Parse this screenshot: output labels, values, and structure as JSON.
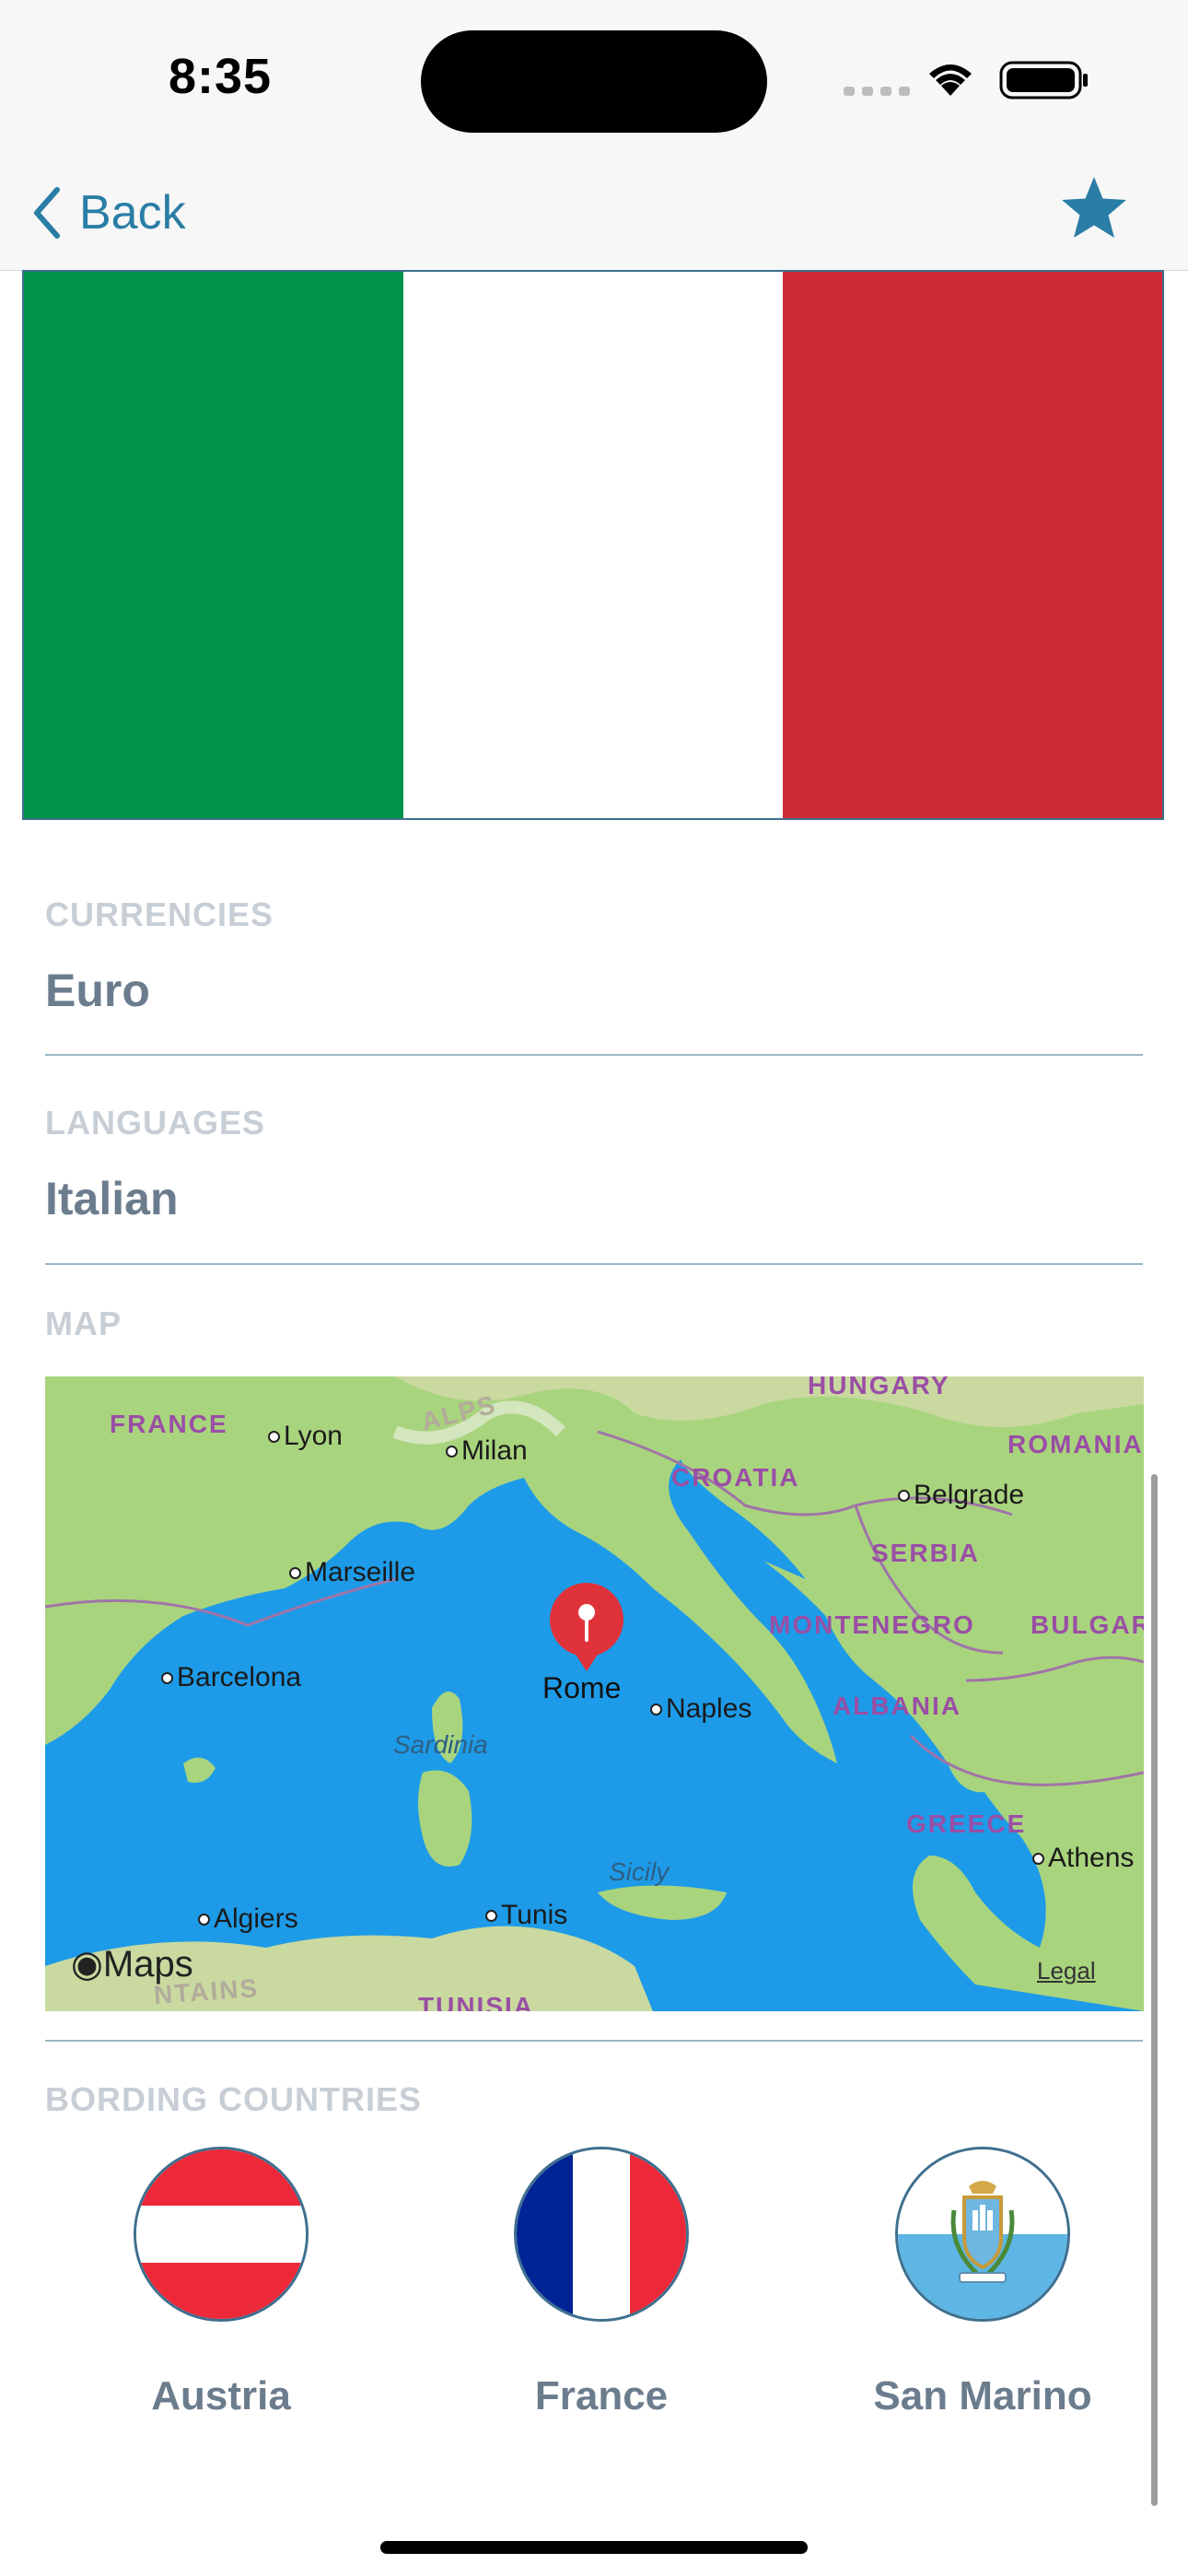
{
  "status": {
    "time": "8:35"
  },
  "nav": {
    "back_label": "Back"
  },
  "flag": {
    "colors": [
      "#009246",
      "#ffffff",
      "#ce2b37"
    ]
  },
  "currencies": {
    "label": "CURRENCIES",
    "value": "Euro"
  },
  "languages": {
    "label": "LANGUAGES",
    "value": "Italian"
  },
  "map": {
    "label": "MAP",
    "pin_label": "Rome",
    "brand": "Maps",
    "legal": "Legal",
    "countries": [
      "FRANCE",
      "HUNGARY",
      "ROMANIA",
      "CROATIA",
      "SERBIA",
      "MONTENEGRO",
      "BULGAR",
      "ALBANIA",
      "GREECE",
      "TUNISIA"
    ],
    "cities": [
      "Lyon",
      "Milan",
      "Belgrade",
      "Marseille",
      "Barcelona",
      "Naples",
      "Athens",
      "Algiers",
      "Tunis"
    ],
    "regions": [
      "Sardinia",
      "Sicily",
      "ALPS",
      "NTAINS"
    ]
  },
  "bordering": {
    "label": "BORDING COUNTRIES",
    "countries": [
      {
        "name": "Austria"
      },
      {
        "name": "France"
      },
      {
        "name": "San Marino"
      }
    ]
  }
}
